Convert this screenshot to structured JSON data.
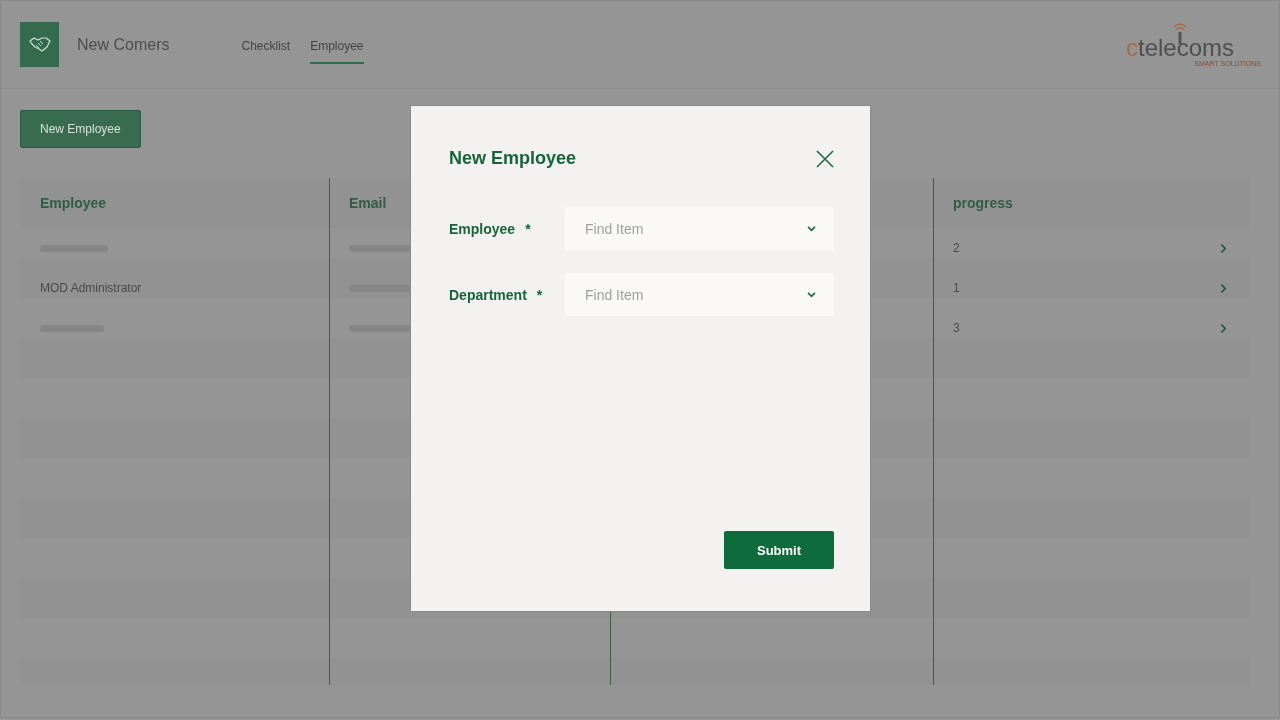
{
  "app": {
    "title": "New Comers"
  },
  "tabs": [
    {
      "label": "Checklist",
      "selected": false
    },
    {
      "label": "Employee",
      "selected": true
    }
  ],
  "logo": {
    "name": "ctelecoms",
    "tagline": "SMART SOLUTIONS"
  },
  "new_button": {
    "label": "New Employee"
  },
  "table": {
    "columns": [
      {
        "kind": "text",
        "title": "Employee"
      },
      {
        "kind": "text",
        "title": "Email"
      },
      {
        "kind": "covered"
      },
      {
        "kind": "text",
        "title": "progress"
      }
    ],
    "rows": [
      {
        "employee": {
          "redacted": true
        },
        "email": {
          "redacted": true
        },
        "progress": "2"
      },
      {
        "employee": {
          "redacted": false,
          "text": "MOD Administrator"
        },
        "email": {
          "redacted": true
        },
        "progress": "1"
      },
      {
        "employee": {
          "redacted": true
        },
        "email": {
          "redacted": true
        },
        "progress": "3"
      }
    ]
  },
  "dialog": {
    "title": "New Employee",
    "fields": [
      {
        "label": "Employee",
        "required_mark": "*",
        "placeholder": "Find Item"
      },
      {
        "label": "Department",
        "required_mark": "*",
        "placeholder": "Find Item"
      }
    ],
    "submit": "Submit"
  }
}
